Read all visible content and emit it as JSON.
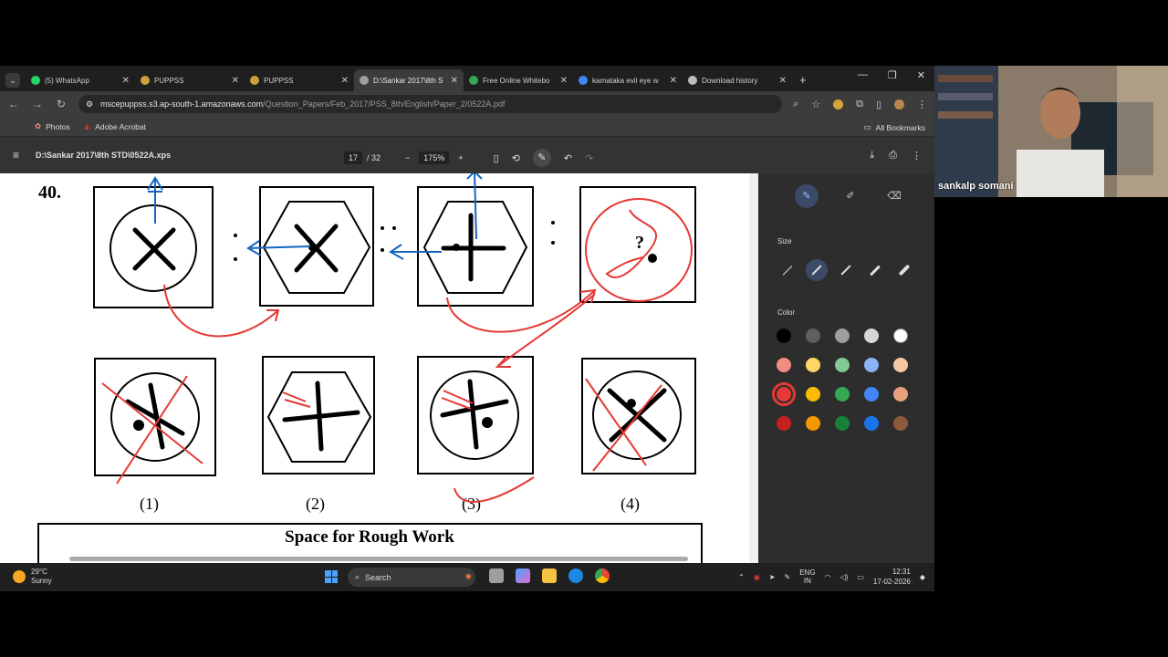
{
  "tabs": [
    {
      "title": "(5) WhatsApp",
      "color": "#25d366"
    },
    {
      "title": "PUPPSS",
      "color": "#c9a23a"
    },
    {
      "title": "PUPPSS",
      "color": "#c9a23a"
    },
    {
      "title": "D:\\Sankar 2017\\8th S",
      "color": "#9aa0a6",
      "active": true
    },
    {
      "title": "Free Online Whitebo",
      "color": "#34a853"
    },
    {
      "title": "karnataka evil eye w",
      "color": "#4285f4"
    },
    {
      "title": "Download history",
      "color": "#bbbbbb"
    }
  ],
  "address": {
    "host": "mscepuppss.s3.ap-south-1.amazonaws.com",
    "path": "/Question_Papers/Feb_2017/PSS_8th/English/Paper_2/0522A.pdf"
  },
  "bookmarks": {
    "photos": "Photos",
    "acrobat": "Adobe Acrobat",
    "all": "All Bookmarks"
  },
  "pdf": {
    "title": "D:\\Sankar 2017\\8th STD\\0522A.xps",
    "page": "17",
    "page_total": "/ 32",
    "zoom": "175%"
  },
  "doc": {
    "question_number": "40.",
    "options": [
      "(1)",
      "(2)",
      "(3)",
      "(4)"
    ],
    "rough_work": "Space for Rough Work",
    "question_mark": "?"
  },
  "annotation_panel": {
    "size_label": "Size",
    "color_label": "Color",
    "colors": [
      "#000000",
      "#5f5f5f",
      "#9e9e9e",
      "#d6d6d6",
      "#ffffff",
      "#f28b82",
      "#fdd663",
      "#81c995",
      "#8ab4f8",
      "#f6c7a1",
      "#e53935",
      "#fbbc04",
      "#34a853",
      "#4285f4",
      "#e8a07d",
      "#c5221f",
      "#f29900",
      "#188038",
      "#1a73e8",
      "#8d5a3b"
    ],
    "selected_color": "#e53935"
  },
  "taskbar": {
    "temp": "29°C",
    "weather": "Sunny",
    "search": "Search",
    "lang1": "ENG",
    "lang2": "IN",
    "time": "12:31",
    "date": "17-02-2026"
  },
  "webcam": {
    "name": "sankalp somani"
  }
}
